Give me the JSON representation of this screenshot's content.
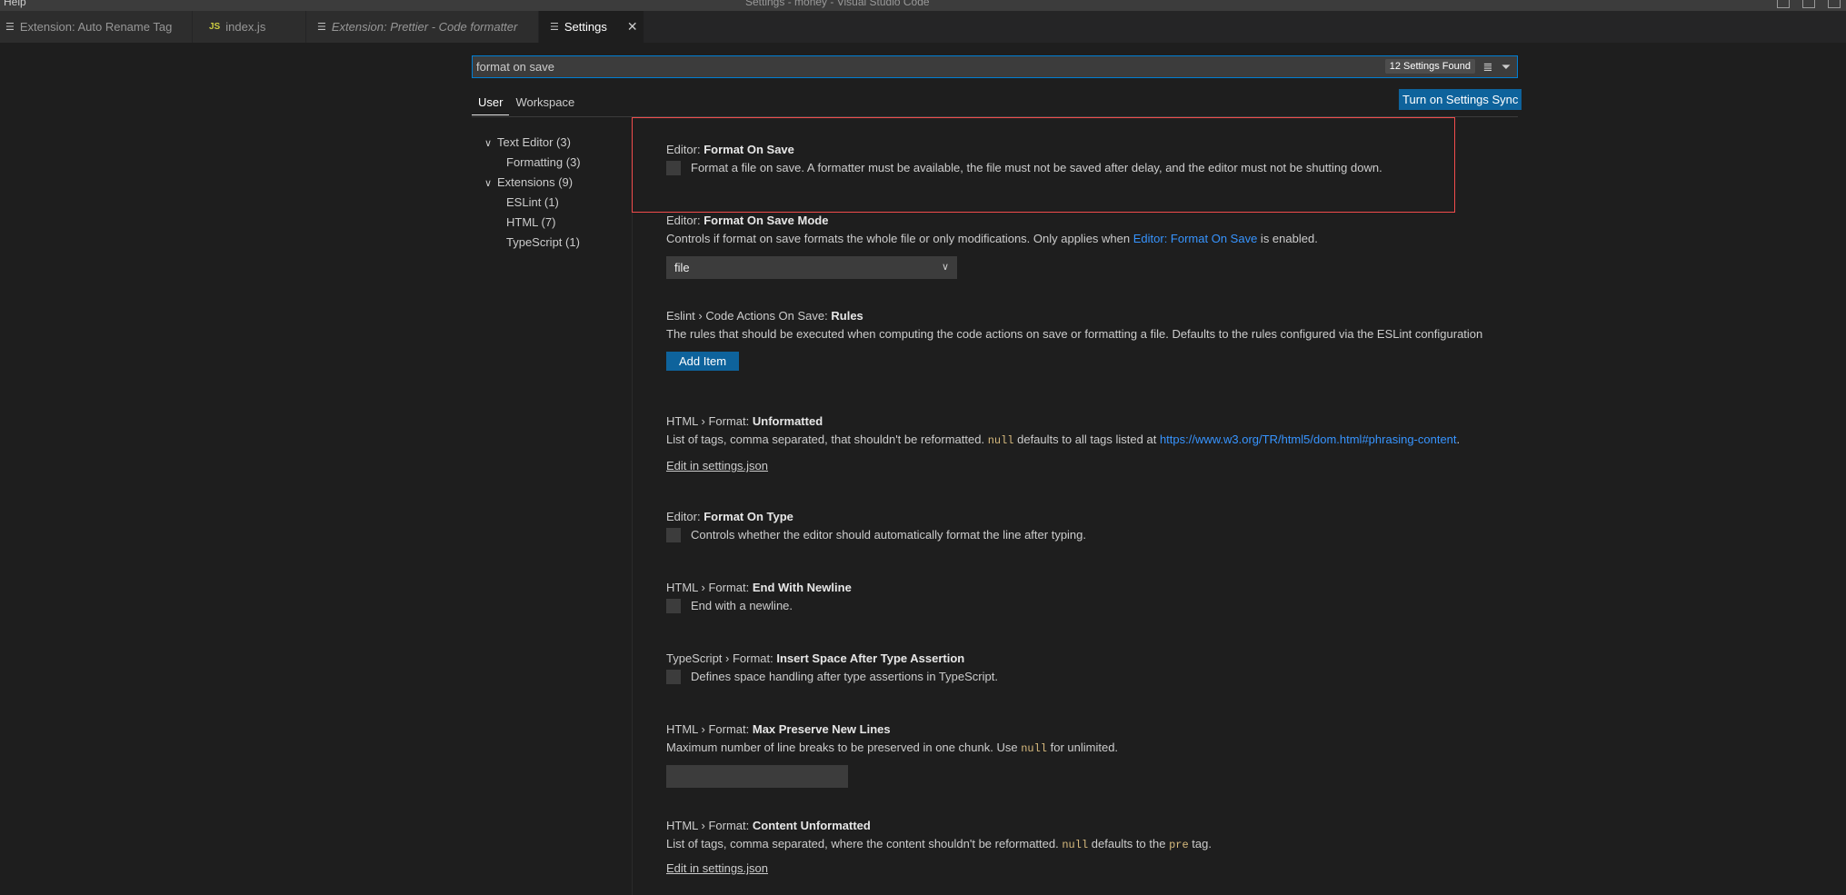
{
  "window": {
    "menu_fragment": "Help",
    "title": "Settings - money - Visual Studio Code"
  },
  "tabs": [
    {
      "label": "Extension: Auto Rename Tag",
      "icon": "extension-preview-icon"
    },
    {
      "label": "index.js",
      "icon": "js-file-icon",
      "icon_text": "JS"
    },
    {
      "label": "Extension: Prettier - Code formatter",
      "icon": "extension-preview-icon"
    },
    {
      "label": "Settings",
      "icon": "settings-preview-icon"
    }
  ],
  "search": {
    "value": "format on save",
    "results_count": "12 Settings Found"
  },
  "scopes": {
    "user": "User",
    "workspace": "Workspace"
  },
  "sync_button": "Turn on Settings Sync",
  "toc": [
    {
      "label": "Text Editor (3)",
      "expanded": true
    },
    {
      "label": "Formatting (3)"
    },
    {
      "label": "Extensions (9)",
      "expanded": true
    },
    {
      "label": "ESLint (1)"
    },
    {
      "label": "HTML (7)"
    },
    {
      "label": "TypeScript (1)"
    }
  ],
  "settings": [
    {
      "category": "Editor: ",
      "name": "Format On Save",
      "description": "Format a file on save. A formatter must be available, the file must not be saved after delay, and the editor must not be shutting down.",
      "control": "checkbox",
      "checked": false
    },
    {
      "category": "Editor: ",
      "name": "Format On Save Mode",
      "desc_pre": "Controls if format on save formats the whole file or only modifications. Only applies when ",
      "desc_link": "Editor: Format On Save",
      "desc_post": " is enabled.",
      "control": "select",
      "value": "file"
    },
    {
      "category": "Eslint › Code Actions On Save: ",
      "name": "Rules",
      "description": "The rules that should be executed when computing the code actions on save or formatting a file. Defaults to the rules configured via the ESLint configuration",
      "control": "button",
      "button_label": "Add Item"
    },
    {
      "category": "HTML › Format: ",
      "name": "Unformatted",
      "desc_pre": "List of tags, comma separated, that shouldn't be reformatted. ",
      "desc_code": "null",
      "desc_mid": " defaults to all tags listed at ",
      "desc_link": "https://www.w3.org/TR/html5/dom.html#phrasing-content",
      "desc_post": ".",
      "control": "link",
      "link_label": "Edit in settings.json"
    },
    {
      "category": "Editor: ",
      "name": "Format On Type",
      "description": "Controls whether the editor should automatically format the line after typing.",
      "control": "checkbox",
      "checked": false
    },
    {
      "category": "HTML › Format: ",
      "name": "End With Newline",
      "description": "End with a newline.",
      "control": "checkbox",
      "checked": false
    },
    {
      "category": "TypeScript › Format: ",
      "name": "Insert Space After Type Assertion",
      "description": "Defines space handling after type assertions in TypeScript.",
      "control": "checkbox",
      "checked": false
    },
    {
      "category": "HTML › Format: ",
      "name": "Max Preserve New Lines",
      "desc_pre": "Maximum number of line breaks to be preserved in one chunk. Use ",
      "desc_code": "null",
      "desc_post": " for unlimited.",
      "control": "number",
      "value": ""
    },
    {
      "category": "HTML › Format: ",
      "name": "Content Unformatted",
      "desc_pre": "List of tags, comma separated, where the content shouldn't be reformatted. ",
      "desc_code": "null",
      "desc_mid": " defaults to the ",
      "desc_code2": "pre",
      "desc_post": " tag.",
      "control": "link",
      "link_label": "Edit in settings.json"
    }
  ],
  "colors": {
    "background": "#1e1e1e",
    "accent_button": "#0e639c",
    "link": "#3794ff",
    "focus_border": "#f14c4c"
  }
}
